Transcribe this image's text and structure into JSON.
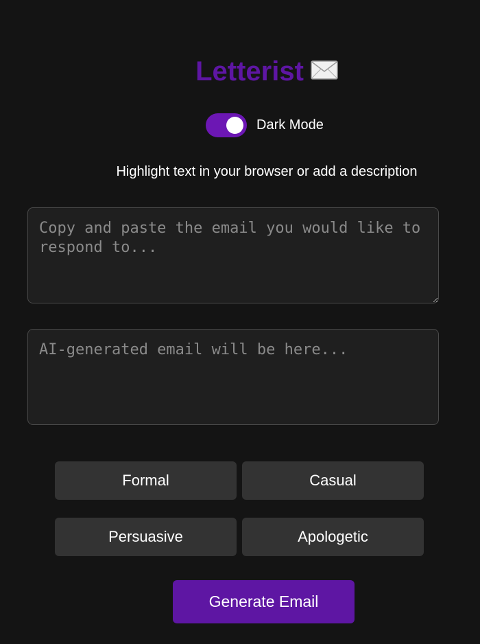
{
  "header": {
    "title": "Letterist",
    "icon": "envelope-icon",
    "title_color": "#5e16a3"
  },
  "dark_mode": {
    "label": "Dark Mode",
    "enabled": true,
    "accent": "#6c17b4"
  },
  "hint": "Highlight text in your browser or add a description",
  "input": {
    "placeholder": "Copy and paste the email you would like to respond to...",
    "value": ""
  },
  "output": {
    "placeholder": "AI-generated email will be here...",
    "value": ""
  },
  "tones": [
    "Formal",
    "Casual",
    "Persuasive",
    "Apologetic"
  ],
  "generate_label": "Generate Email",
  "colors": {
    "background": "#141414",
    "button": "#333333",
    "primary": "#5e16a3"
  }
}
